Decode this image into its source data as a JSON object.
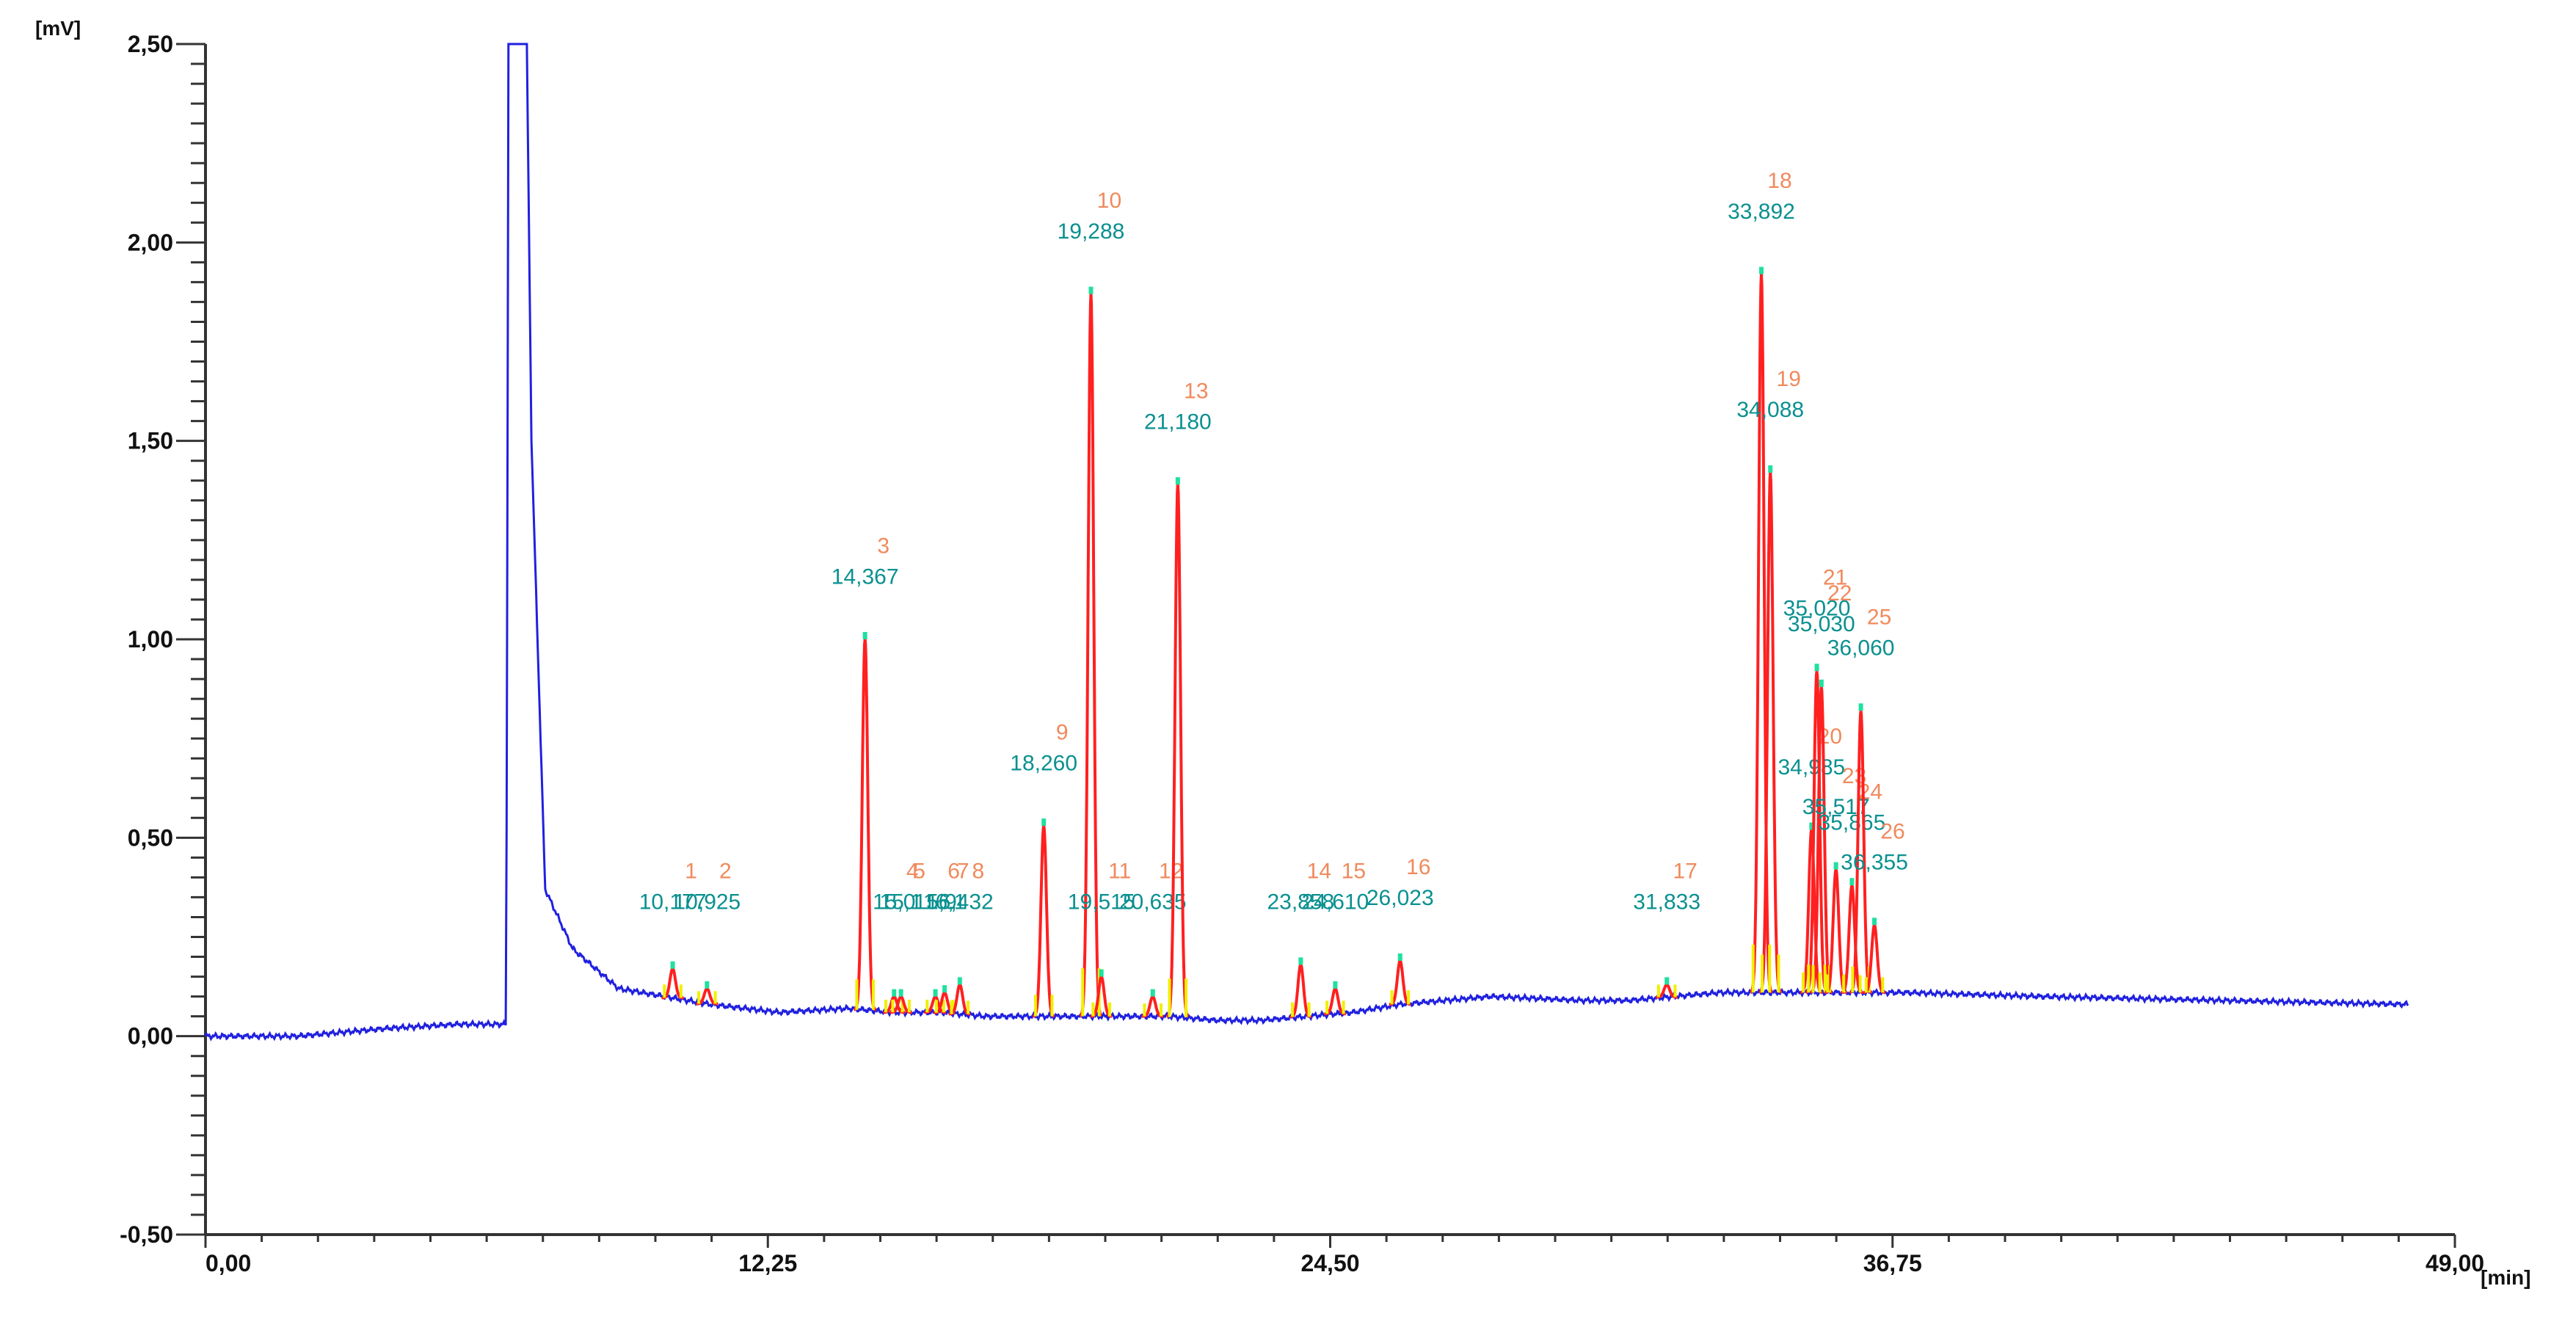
{
  "chart_data": {
    "type": "line",
    "title": "",
    "xlabel": "[min]",
    "ylabel": "[mV]",
    "xlim": [
      0,
      49
    ],
    "ylim": [
      -0.5,
      2.5
    ],
    "x_ticks": [
      0,
      12.25,
      24.5,
      36.75,
      49
    ],
    "x_tick_labels": [
      "0,00",
      "12,25",
      "24,50",
      "36,75",
      "49,00"
    ],
    "y_ticks": [
      2.5,
      2.0,
      1.5,
      1.0,
      0.5,
      0.0,
      -0.5
    ],
    "y_tick_labels": [
      "2,50",
      "2,00",
      "1,50",
      "1,00",
      "0,50",
      "0,00",
      "-0,50"
    ],
    "grid": false,
    "colors": {
      "trace": "#2020e0",
      "peak": "#ff2020",
      "marker": "#f0f000",
      "apex": "#20e0a0",
      "number": "#f08a5d",
      "rt": "#0a9090",
      "axis": "#333333"
    },
    "baseline": {
      "x": [
        0,
        2,
        4,
        5.5,
        6.55,
        6.6,
        7.0,
        7.1,
        7.4,
        8,
        9,
        10,
        11,
        12.5,
        14,
        15,
        16,
        17,
        19,
        21,
        22,
        23,
        24,
        25,
        26,
        27,
        28,
        30,
        31,
        33,
        37,
        40,
        44,
        48
      ],
      "y": [
        0.0,
        0.0,
        0.02,
        0.03,
        0.03,
        2.5,
        2.5,
        1.5,
        0.37,
        0.22,
        0.12,
        0.1,
        0.08,
        0.06,
        0.07,
        0.06,
        0.06,
        0.05,
        0.05,
        0.05,
        0.04,
        0.04,
        0.05,
        0.06,
        0.08,
        0.09,
        0.1,
        0.09,
        0.09,
        0.11,
        0.11,
        0.1,
        0.09,
        0.08
      ]
    },
    "peaks": [
      {
        "num": "1",
        "rt": "10,177",
        "time": 10.177,
        "height": 0.17
      },
      {
        "num": "2",
        "rt": "10,925",
        "time": 10.925,
        "height": 0.12
      },
      {
        "num": "3",
        "rt": "14,367",
        "time": 14.367,
        "height": 1.0
      },
      {
        "num": "4",
        "rt": "15,0",
        "time": 15.0,
        "height": 0.1
      },
      {
        "num": "5",
        "rt": "15,1",
        "time": 15.15,
        "height": 0.1
      },
      {
        "num": "6",
        "rt": "15,9",
        "time": 15.9,
        "height": 0.1
      },
      {
        "num": "7",
        "rt": "16,1",
        "time": 16.1,
        "height": 0.11
      },
      {
        "num": "8",
        "rt": "16,432",
        "time": 16.432,
        "height": 0.13
      },
      {
        "num": "9",
        "rt": "18,260",
        "time": 18.26,
        "height": 0.53
      },
      {
        "num": "10",
        "rt": "19,288",
        "time": 19.288,
        "height": 1.87
      },
      {
        "num": "11",
        "rt": "19,515",
        "time": 19.515,
        "height": 0.15
      },
      {
        "num": "12",
        "rt": "20,635",
        "time": 20.635,
        "height": 0.1
      },
      {
        "num": "13",
        "rt": "21,180",
        "time": 21.18,
        "height": 1.39
      },
      {
        "num": "14",
        "rt": "23,858",
        "time": 23.858,
        "height": 0.18
      },
      {
        "num": "15",
        "rt": "24,610",
        "time": 24.61,
        "height": 0.12
      },
      {
        "num": "16",
        "rt": "26,023",
        "time": 26.023,
        "height": 0.19
      },
      {
        "num": "17",
        "rt": "31,833",
        "time": 31.833,
        "height": 0.13
      },
      {
        "num": "18",
        "rt": "33,892",
        "time": 33.892,
        "height": 1.92
      },
      {
        "num": "19",
        "rt": "34,088",
        "time": 34.088,
        "height": 1.42
      },
      {
        "num": "20",
        "rt": "34,985",
        "time": 34.985,
        "height": 0.52
      },
      {
        "num": "21",
        "rt": "35,020",
        "time": 35.1,
        "height": 0.92
      },
      {
        "num": "22",
        "rt": "35,030",
        "time": 35.2,
        "height": 0.88
      },
      {
        "num": "23",
        "rt": "35,517",
        "time": 35.517,
        "height": 0.42
      },
      {
        "num": "24",
        "rt": "35,865",
        "time": 35.865,
        "height": 0.38
      },
      {
        "num": "25",
        "rt": "36,060",
        "time": 36.06,
        "height": 0.82
      },
      {
        "num": "26",
        "rt": "36,355",
        "time": 36.355,
        "height": 0.28
      }
    ]
  }
}
